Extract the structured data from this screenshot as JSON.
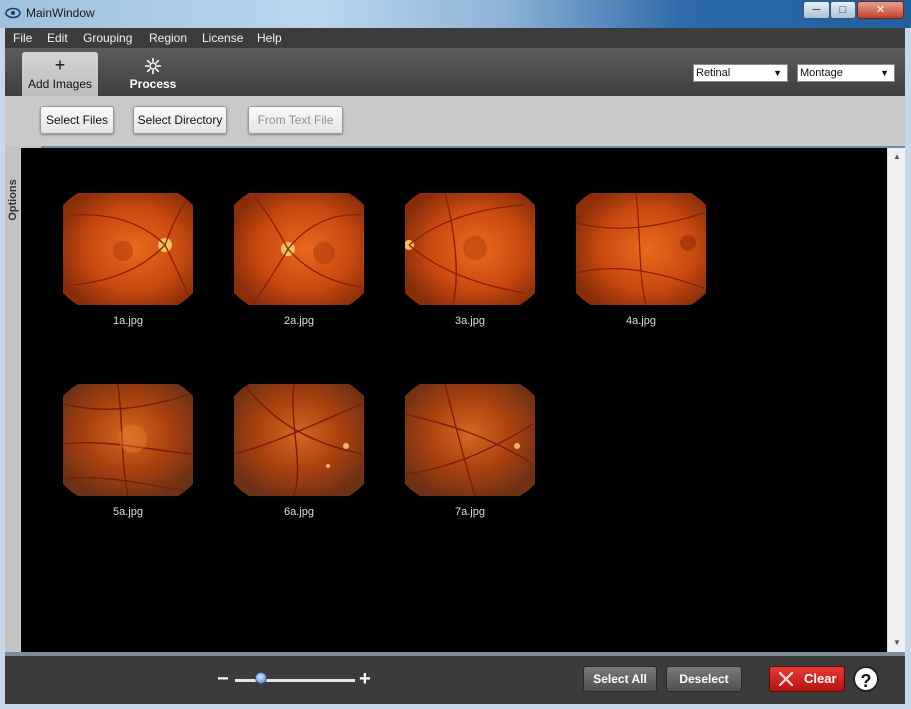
{
  "window": {
    "title": "MainWindow"
  },
  "menu": [
    "File",
    "Edit",
    "Grouping",
    "Region",
    "License",
    "Help"
  ],
  "tabs": {
    "add_images": {
      "label": "Add Images"
    },
    "process": {
      "label": "Process"
    }
  },
  "selects": {
    "image_type": "Retinal",
    "mode": "Montage"
  },
  "buttons": {
    "select_files": "Select Files",
    "select_directory": "Select Directory",
    "from_text_file": "From Text File",
    "select_all": "Select All",
    "deselect": "Deselect",
    "clear": "Clear"
  },
  "options_panel": {
    "label": "Options",
    "chevron": "<<"
  },
  "images": [
    "1a.jpg",
    "2a.jpg",
    "3a.jpg",
    "4a.jpg",
    "5a.jpg",
    "6a.jpg",
    "7a.jpg"
  ],
  "zoom": {
    "minus": "−",
    "plus": "+",
    "level": 0.22
  },
  "colors": {
    "accent": "#5d8fd0",
    "clear_red": "#d0201a"
  }
}
